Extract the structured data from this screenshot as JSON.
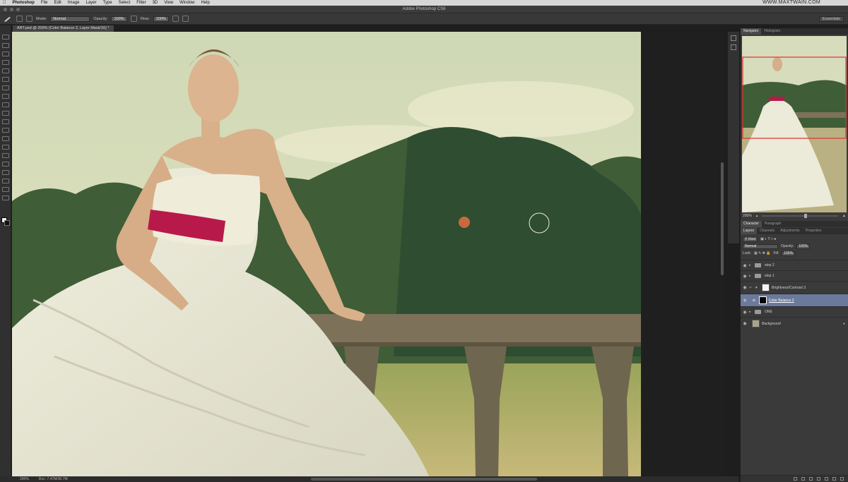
{
  "menubar": {
    "apple": "",
    "app_name": "Photoshop",
    "items": [
      "File",
      "Edit",
      "Image",
      "Layer",
      "Type",
      "Select",
      "Filter",
      "3D",
      "View",
      "Window",
      "Help"
    ],
    "watermark": "WWW.MAXTWAIN.COM"
  },
  "window": {
    "title": "Adobe Photoshop CS6"
  },
  "options": {
    "mode_label": "Mode:",
    "mode_value": "Normal",
    "opacity_label": "Opacity:",
    "opacity_value": "100%",
    "flow_label": "Flow:",
    "flow_value": "100%",
    "workspace": "Essentials"
  },
  "document": {
    "tab_label": "ART.psd @ 200% (Color Balance 2, Layer Mask/16) *"
  },
  "status": {
    "zoom": "200%",
    "doc_size": "Doc: 7.47M/30.7M"
  },
  "navigator": {
    "tabs": [
      "Navigator",
      "Histogram"
    ],
    "zoom": "200%"
  },
  "character_tabs": [
    "Character",
    "Paragraph"
  ],
  "layers_panel": {
    "tabs": [
      "Layers",
      "Channels",
      "Adjustments",
      "Properties"
    ],
    "kind_label": "Kind",
    "blend_mode": "Normal",
    "opacity_label": "Opacity:",
    "opacity_value": "100%",
    "lock_label": "Lock:",
    "fill_label": "Fill:",
    "fill_value": "100%",
    "layers": [
      {
        "name": "step 2",
        "type": "group"
      },
      {
        "name": "step 1",
        "type": "group"
      },
      {
        "name": "Brightness/Contrast 3",
        "type": "adjustment"
      },
      {
        "name": "Color Balance 2",
        "type": "adjustment",
        "selected": true
      },
      {
        "name": "ONE",
        "type": "group"
      },
      {
        "name": "Background",
        "type": "pixel"
      }
    ]
  },
  "colors": {
    "accent_selection": "#6b7a9c",
    "ribbon": "#b8194b",
    "panel_bg": "#3a3a3a"
  }
}
